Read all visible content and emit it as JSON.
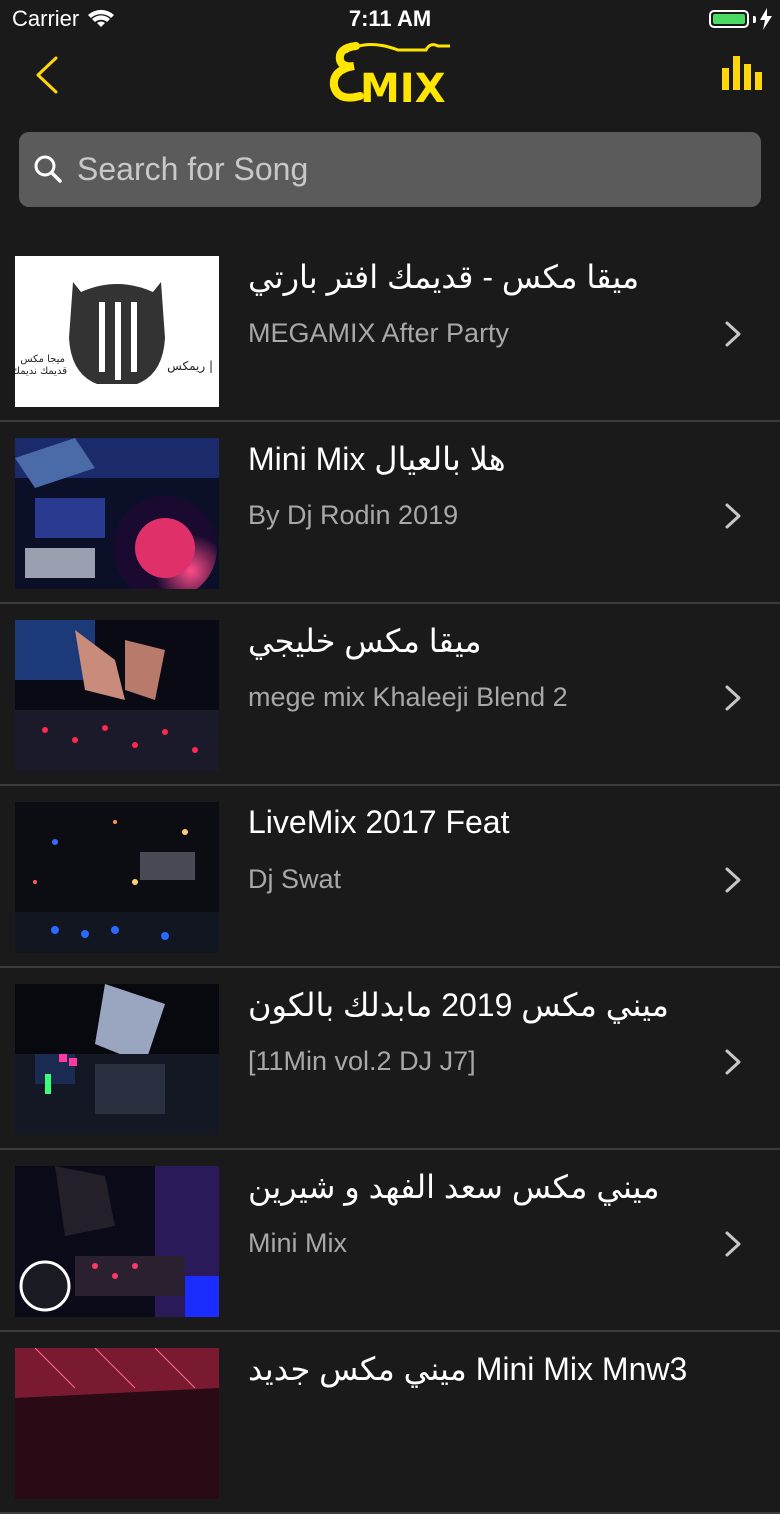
{
  "status_bar": {
    "carrier": "Carrier",
    "time": "7:11 AM"
  },
  "nav": {
    "logo_text": "MIX",
    "logo_accent": "#ffe500",
    "accent_color": "#ffd60a"
  },
  "search": {
    "placeholder": "Search for Song",
    "value": ""
  },
  "songs": [
    {
      "title": "ميقا مكس - قديمك افتر بارتي",
      "subtitle": "MEGAMIX After Party",
      "thumb_caption_line1": "ميجا مكس",
      "thumb_caption_line2": "قديمك نديمك",
      "thumb_caption_right": "ريمكس |"
    },
    {
      "title": "Mini Mix  هلا بالعيال",
      "subtitle": "By Dj Rodin 2019"
    },
    {
      "title": "ميقا مكس خليجي",
      "subtitle": "mege mix Khaleeji Blend 2"
    },
    {
      "title": "LiveMix 2017 Feat",
      "subtitle": "Dj Swat"
    },
    {
      "title": "ميني مكس 2019  مابدلك بالكون",
      "subtitle": "[11Min vol.2 DJ J7]"
    },
    {
      "title": "ميني مكس سعد الفهد و شيرين",
      "subtitle": "Mini Mix"
    },
    {
      "title": "ميني مكس جديد Mini Mix  Mnw3",
      "subtitle": ""
    }
  ]
}
